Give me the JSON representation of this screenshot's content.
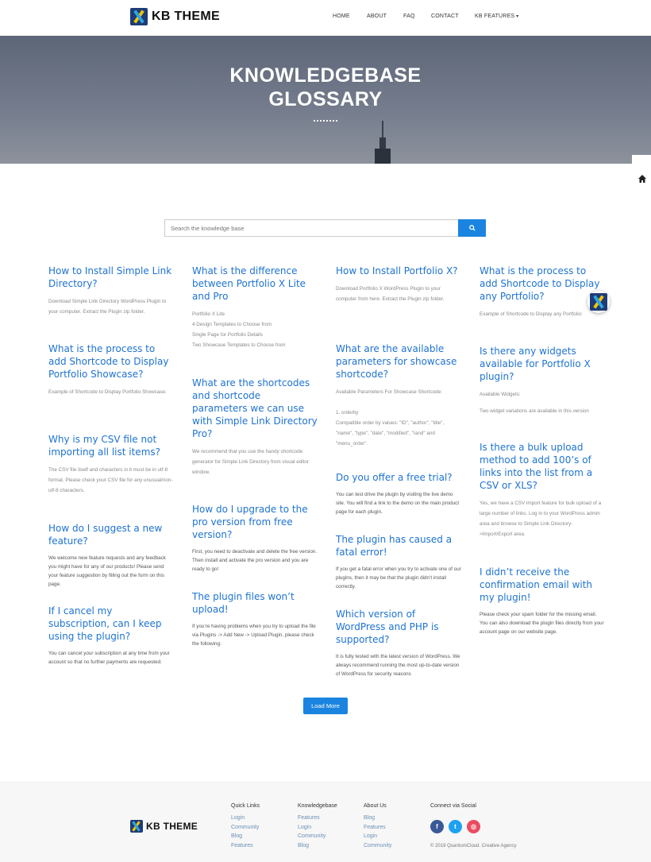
{
  "header": {
    "logo_text": "KB THEME",
    "nav": [
      "HOME",
      "ABOUT",
      "FAQ",
      "CONTACT",
      "KB FEATURES"
    ]
  },
  "hero": {
    "title_line1": "KNOWLEDGEBASE",
    "title_line2": "GLOSSARY"
  },
  "search": {
    "placeholder": "Search the knowledge base"
  },
  "articles": [
    {
      "title": "How to Install Simple Link Directory?",
      "body": "Download Simple Link Directory WordPress Plugin to your computer. Extract the Plugin zip folder."
    },
    {
      "title": "What is the process to add Shortcode to Display Portfolio Showcase?",
      "body": "Example of Shortcode to Display Portfolio Showcase:"
    },
    {
      "title": "Why is my CSV file not importing all list items?",
      "body": "The CSV file itself and characters in it must be in utf-8 format. Please check your CSV file for any unusual/non-utf-8 characters."
    },
    {
      "title": "How do I suggest a new feature?",
      "body": "We welcome new feature requests and any feedback you might have for any of our products! Please send your feature suggestion by filling out the form on this page."
    },
    {
      "title": "If I cancel my subscription, can I keep using the plugin?",
      "body": "You can cancel your subscription at any time from your account so that no further payments are requested."
    },
    {
      "title": "What is the difference between Portfolio X Lite and Pro",
      "body_lines": [
        "Portfolio X Lite",
        "4 Design Templates to Choose from",
        "Single Page for Portfolio Details",
        "Two Showcase Templates to Choose from"
      ]
    },
    {
      "title": "What are the shortcodes and shortcode parameters we can use with Simple Link Directory Pro?",
      "body": "We recommend that you use the handy shortcode generator for Simple Link Directory from visual editor window."
    },
    {
      "title": "How do I upgrade to the pro version from free version?",
      "body": "First, you need to deactivate and delete the free version. Then install and activate the pro version and you are ready to go!"
    },
    {
      "title": "The plugin files won’t upload!",
      "body": "If you’re having problems when you try to upload the file via Plugins -> Add New -> Upload Plugin, please check the following:"
    },
    {
      "title": "How to Install Portfolio X?",
      "body": "Download Portfolio X WordPress Plugin to your computer from here. Extract the Plugin zip folder."
    },
    {
      "title": "What are the available parameters for showcase shortcode?",
      "body_lines": [
        "Available Parameters For Showcase Shortcode:",
        "",
        "1. orderby",
        "Compatible order by values: \"ID\", \"author\", \"title\", \"name\", \"type\", \"date\", \"modified\", \"rand\" and \"menu_order\"."
      ]
    },
    {
      "title": "Do you offer a free trial?",
      "body": "You can test drive the plugin by visiting the live demo site. You will find a link to the demo on the main product page for each plugin."
    },
    {
      "title": "The plugin has caused a fatal error!",
      "body": "If you get a fatal error when you try to activate one of our plugins, then it may be that the plugin didn’t install correctly."
    },
    {
      "title": "Which version of WordPress and PHP is supported?",
      "body": "It is fully tested with the latest version of WordPress. We always recommend running the most up-to-date version of WordPress for security reasons"
    },
    {
      "title": "What is the process to add Shortcode to Display any Portfolio?",
      "body": "Example of Shortcode to Display any Portfolio:"
    },
    {
      "title": "Is there any widgets available for Portfolio X plugin?",
      "body_lines": [
        "Available Widgets:",
        "",
        "Two widget variations are available in this version"
      ]
    },
    {
      "title": "Is there a bulk upload method to add 100’s of links into the list from a CSV or XLS?",
      "body": "Yes, we have a CSV import feature for bulk upload of a large number of links. Log in to your WordPress admin area and browse to Simple Link Directory->Import/Export area."
    },
    {
      "title": "I didn’t receive the confirmation email with my plugin!",
      "body": "Please check your spam folder for the missing email. You can also download the plugin files  directly from your account page on our website page."
    }
  ],
  "load_more_label": "Load More",
  "footer": {
    "logo_text": "KB THEME",
    "columns": [
      {
        "title": "Quick Links",
        "links": [
          "Login",
          "Community",
          "Blog",
          "Features"
        ]
      },
      {
        "title": "Knowledgebase",
        "links": [
          "Features",
          "Login",
          "Community",
          "Blog"
        ]
      },
      {
        "title": "About Us",
        "links": [
          "Blog",
          "Features",
          "Login",
          "Community"
        ]
      }
    ],
    "social_title": "Connect via Social",
    "social": [
      {
        "icon": "facebook-icon",
        "glyph": "f",
        "color": "#3b5998"
      },
      {
        "icon": "twitter-icon",
        "glyph": "t",
        "color": "#1da1f2"
      },
      {
        "icon": "dribbble-icon",
        "glyph": "◎",
        "color": "#ea4c60"
      }
    ],
    "copyright": "© 2019 QuantumCloud. Creative Agency"
  },
  "colors": {
    "accent": "#1b84e0",
    "link": "#1e73d2"
  }
}
